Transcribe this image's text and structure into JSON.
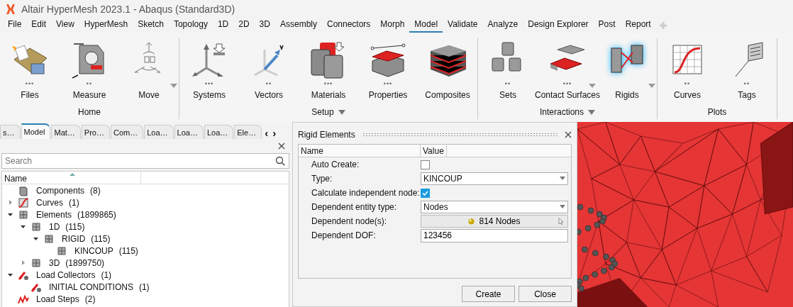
{
  "window": {
    "title": "Altair HyperMesh 2023.1 - Abaqus (Standard3D)"
  },
  "menu": [
    {
      "label": "File",
      "selected": false
    },
    {
      "label": "Edit",
      "selected": false
    },
    {
      "label": "View",
      "selected": false
    },
    {
      "label": "HyperMesh",
      "selected": false
    },
    {
      "label": "Sketch",
      "selected": false
    },
    {
      "label": "Topology",
      "selected": false
    },
    {
      "label": "1D",
      "selected": false
    },
    {
      "label": "2D",
      "selected": false
    },
    {
      "label": "3D",
      "selected": false
    },
    {
      "label": "Assembly",
      "selected": false
    },
    {
      "label": "Connectors",
      "selected": false
    },
    {
      "label": "Morph",
      "selected": false
    },
    {
      "label": "Model",
      "selected": true
    },
    {
      "label": "Validate",
      "selected": false
    },
    {
      "label": "Analyze",
      "selected": false
    },
    {
      "label": "Design Explorer",
      "selected": false
    },
    {
      "label": "Post",
      "selected": false
    },
    {
      "label": "Report",
      "selected": false
    }
  ],
  "ribbon": [
    {
      "label": "Home",
      "dropdown": false,
      "tools": [
        {
          "label": "Files",
          "more": "•••",
          "dropdown": false,
          "selected": false
        },
        {
          "label": "Measure",
          "more": "••",
          "dropdown": false,
          "selected": false
        },
        {
          "label": "Move",
          "dropdown": true,
          "selected": false
        }
      ]
    },
    {
      "label": "Setup",
      "dropdown": true,
      "tools": [
        {
          "label": "Systems",
          "more": "•••",
          "dropdown": false,
          "selected": false
        },
        {
          "label": "Vectors",
          "more": "••",
          "dropdown": false,
          "selected": false
        },
        {
          "label": "Materials",
          "more": "•••",
          "dropdown": false,
          "selected": false
        },
        {
          "label": "Properties",
          "more": "•••",
          "dropdown": false,
          "selected": false
        },
        {
          "label": "Composites",
          "dropdown": false,
          "selected": false
        }
      ]
    },
    {
      "label": "Interactions",
      "dropdown": true,
      "tools": [
        {
          "label": "Sets",
          "more": "••",
          "dropdown": false,
          "selected": false
        },
        {
          "label": "Contact Surfaces",
          "more": "•••",
          "dropdown": true,
          "selected": false
        },
        {
          "label": "Rigids",
          "dropdown": true,
          "selected": true
        }
      ]
    },
    {
      "label": "Plots",
      "dropdown": false,
      "tools": [
        {
          "label": "Curves",
          "more": "••",
          "dropdown": false,
          "selected": false
        },
        {
          "label": "Tags",
          "more": "••",
          "dropdown": false,
          "selected": false
        }
      ]
    }
  ],
  "browser": {
    "tabs": [
      {
        "label": "s…",
        "selected": false
      },
      {
        "label": "Model",
        "selected": true
      },
      {
        "label": "Mat…",
        "selected": false
      },
      {
        "label": "Pro…",
        "selected": false
      },
      {
        "label": "Com…",
        "selected": false
      },
      {
        "label": "Loa…",
        "selected": false
      },
      {
        "label": "Loa…",
        "selected": false
      },
      {
        "label": "Loa…",
        "selected": false
      },
      {
        "label": "Ele…",
        "selected": false
      }
    ],
    "scroll_left": "‹",
    "scroll_right": "›",
    "search": {
      "placeholder": "Search"
    },
    "column": "Name",
    "tree": [
      {
        "kind": "component",
        "name": "Components",
        "count": "(8)"
      },
      {
        "kind": "curve",
        "name": "Curves",
        "count": "(1)",
        "expanded": false
      },
      {
        "kind": "element",
        "name": "Elements",
        "count": "(1899865)",
        "expanded": true,
        "children": [
          {
            "kind": "element",
            "name": "1D",
            "count": "(115)",
            "expanded": true,
            "children": [
              {
                "kind": "element",
                "name": "RIGID",
                "count": "(115)",
                "expanded": true,
                "children": [
                  {
                    "kind": "element",
                    "name": "KINCOUP",
                    "count": "(115)"
                  }
                ]
              }
            ]
          },
          {
            "kind": "element",
            "name": "3D",
            "count": "(1899750)",
            "expanded": false
          }
        ]
      },
      {
        "kind": "load",
        "name": "Load Collectors",
        "count": "(1)",
        "expanded": true,
        "children": [
          {
            "kind": "load",
            "name": "INITIAL CONDITIONS",
            "count": "(1)"
          }
        ]
      },
      {
        "kind": "loadstep",
        "name": "Load Steps",
        "count": "(2)"
      }
    ]
  },
  "dialog": {
    "title": "Rigid Elements",
    "columns": [
      "Name",
      "Value"
    ],
    "rows": [
      {
        "kind": "checkbox",
        "label": "Auto Create:",
        "checked": false
      },
      {
        "kind": "dropdown",
        "label": "Type:",
        "value": "KINCOUP"
      },
      {
        "kind": "checkbox",
        "label": "Calculate independent node:",
        "checked": true
      },
      {
        "kind": "dropdown",
        "label": "Dependent entity type:",
        "value": "Nodes"
      },
      {
        "kind": "selector",
        "label": "Dependent node(s):",
        "value": "814 Nodes"
      },
      {
        "kind": "text",
        "label": "Dependent DOF:",
        "value": "123456"
      }
    ],
    "buttons": [
      "Create",
      "Close"
    ]
  }
}
